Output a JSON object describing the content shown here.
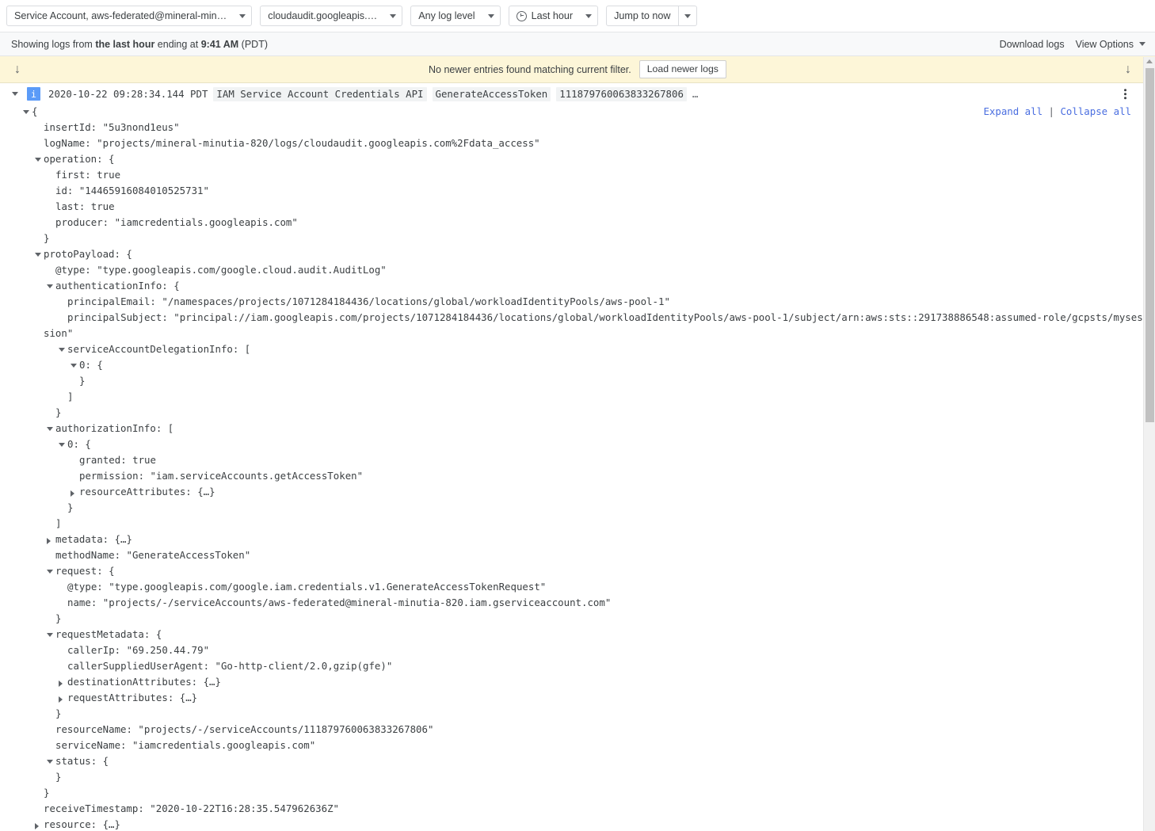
{
  "toolbar": {
    "filters": [
      {
        "label": "Service Account, aws-federated@mineral-min…",
        "icon": "",
        "split": false
      },
      {
        "label": "cloudaudit.googleapis.…",
        "icon": "",
        "split": false
      },
      {
        "label": "Any log level",
        "icon": "",
        "split": false
      },
      {
        "label": "Last hour",
        "icon": "clock-icon",
        "split": false
      },
      {
        "label": "Jump to now",
        "icon": "",
        "split": true
      }
    ]
  },
  "info_strip": {
    "prefix": "Showing logs from ",
    "range": "the last hour",
    "middle": " ending at ",
    "time": "9:41 AM",
    "suffix": " (PDT)",
    "download_logs": "Download logs",
    "view_options": "View Options"
  },
  "banner": {
    "message": "No newer entries found matching current filter.",
    "button": "Load newer logs",
    "arrow_glyph": "↓"
  },
  "entry": {
    "severity": "i",
    "timestamp": "2020-10-22 09:28:34.144 PDT",
    "chips": [
      "IAM Service Account Credentials API",
      "GenerateAccessToken",
      "111879760063833267806"
    ],
    "ellipsis": "…",
    "expand_all": "Expand all",
    "separator": " | ",
    "collapse_all": "Collapse all"
  },
  "json_lines": [
    {
      "indent": 0,
      "twisty": "down",
      "text": "{"
    },
    {
      "indent": 1,
      "twisty": "none",
      "text": "insertId: \"5u3nond1eus\""
    },
    {
      "indent": 1,
      "twisty": "none",
      "text": "logName: \"projects/mineral-minutia-820/logs/cloudaudit.googleapis.com%2Fdata_access\""
    },
    {
      "indent": 1,
      "twisty": "down",
      "text": "operation: {"
    },
    {
      "indent": 2,
      "twisty": "none",
      "text": "first: true"
    },
    {
      "indent": 2,
      "twisty": "none",
      "text": "id: \"14465916084010525731\""
    },
    {
      "indent": 2,
      "twisty": "none",
      "text": "last: true"
    },
    {
      "indent": 2,
      "twisty": "none",
      "text": "producer: \"iamcredentials.googleapis.com\""
    },
    {
      "indent": 1,
      "twisty": "none",
      "text": "}"
    },
    {
      "indent": 1,
      "twisty": "down",
      "text": "protoPayload: {"
    },
    {
      "indent": 2,
      "twisty": "none",
      "text": "@type: \"type.googleapis.com/google.cloud.audit.AuditLog\""
    },
    {
      "indent": 2,
      "twisty": "down",
      "text": "authenticationInfo: {"
    },
    {
      "indent": 3,
      "twisty": "none",
      "text": "principalEmail: \"/namespaces/projects/1071284184436/locations/global/workloadIdentityPools/aws-pool-1\""
    },
    {
      "indent": 3,
      "twisty": "none",
      "text": "principalSubject: \"principal://iam.googleapis.com/projects/1071284184436/locations/global/workloadIdentityPools/aws-pool-1/subject/arn:aws:sts::291738886548:assumed-role/gcpsts/myses"
    },
    {
      "indent": 1,
      "twisty": "none",
      "text": "sion\""
    },
    {
      "indent": 3,
      "twisty": "down",
      "text": "serviceAccountDelegationInfo: ["
    },
    {
      "indent": 4,
      "twisty": "down",
      "text": "0: {"
    },
    {
      "indent": 4,
      "twisty": "none",
      "text": "}"
    },
    {
      "indent": 3,
      "twisty": "none",
      "text": "]"
    },
    {
      "indent": 2,
      "twisty": "none",
      "text": "}"
    },
    {
      "indent": 2,
      "twisty": "down",
      "text": "authorizationInfo: ["
    },
    {
      "indent": 3,
      "twisty": "down",
      "text": "0: {"
    },
    {
      "indent": 4,
      "twisty": "none",
      "text": "granted: true"
    },
    {
      "indent": 4,
      "twisty": "none",
      "text": "permission: \"iam.serviceAccounts.getAccessToken\""
    },
    {
      "indent": 4,
      "twisty": "right",
      "text": "resourceAttributes: {…}"
    },
    {
      "indent": 3,
      "twisty": "none",
      "text": "}"
    },
    {
      "indent": 2,
      "twisty": "none",
      "text": "]"
    },
    {
      "indent": 2,
      "twisty": "right",
      "text": "metadata: {…}"
    },
    {
      "indent": 2,
      "twisty": "none",
      "text": "methodName: \"GenerateAccessToken\""
    },
    {
      "indent": 2,
      "twisty": "down",
      "text": "request: {"
    },
    {
      "indent": 3,
      "twisty": "none",
      "text": "@type: \"type.googleapis.com/google.iam.credentials.v1.GenerateAccessTokenRequest\""
    },
    {
      "indent": 3,
      "twisty": "none",
      "text": "name: \"projects/-/serviceAccounts/aws-federated@mineral-minutia-820.iam.gserviceaccount.com\""
    },
    {
      "indent": 2,
      "twisty": "none",
      "text": "}"
    },
    {
      "indent": 2,
      "twisty": "down",
      "text": "requestMetadata: {"
    },
    {
      "indent": 3,
      "twisty": "none",
      "text": "callerIp: \"69.250.44.79\""
    },
    {
      "indent": 3,
      "twisty": "none",
      "text": "callerSuppliedUserAgent: \"Go-http-client/2.0,gzip(gfe)\""
    },
    {
      "indent": 3,
      "twisty": "right",
      "text": "destinationAttributes: {…}"
    },
    {
      "indent": 3,
      "twisty": "right",
      "text": "requestAttributes: {…}"
    },
    {
      "indent": 2,
      "twisty": "none",
      "text": "}"
    },
    {
      "indent": 2,
      "twisty": "none",
      "text": "resourceName: \"projects/-/serviceAccounts/111879760063833267806\""
    },
    {
      "indent": 2,
      "twisty": "none",
      "text": "serviceName: \"iamcredentials.googleapis.com\""
    },
    {
      "indent": 2,
      "twisty": "down",
      "text": "status: {"
    },
    {
      "indent": 2,
      "twisty": "none",
      "text": "}"
    },
    {
      "indent": 1,
      "twisty": "none",
      "text": "}"
    },
    {
      "indent": 1,
      "twisty": "none",
      "text": "receiveTimestamp: \"2020-10-22T16:28:35.547962636Z\""
    },
    {
      "indent": 1,
      "twisty": "right",
      "text": "resource: {…}"
    }
  ],
  "colors": {
    "severity_info": "#5b9bf8",
    "banner_bg": "#fdf6d8",
    "chip_bg": "#f1f3f4",
    "link": "#4a6ee0"
  }
}
